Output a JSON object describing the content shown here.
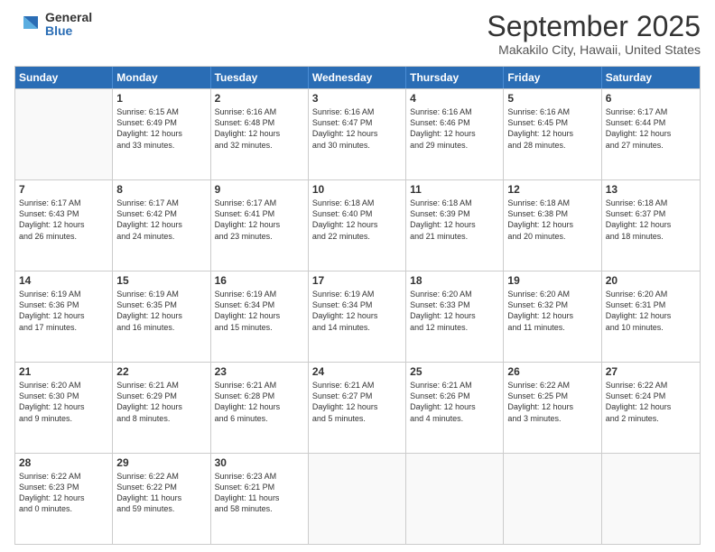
{
  "logo": {
    "general": "General",
    "blue": "Blue"
  },
  "title": "September 2025",
  "location": "Makakilo City, Hawaii, United States",
  "header_days": [
    "Sunday",
    "Monday",
    "Tuesday",
    "Wednesday",
    "Thursday",
    "Friday",
    "Saturday"
  ],
  "weeks": [
    [
      {
        "day": "",
        "text": ""
      },
      {
        "day": "1",
        "text": "Sunrise: 6:15 AM\nSunset: 6:49 PM\nDaylight: 12 hours\nand 33 minutes."
      },
      {
        "day": "2",
        "text": "Sunrise: 6:16 AM\nSunset: 6:48 PM\nDaylight: 12 hours\nand 32 minutes."
      },
      {
        "day": "3",
        "text": "Sunrise: 6:16 AM\nSunset: 6:47 PM\nDaylight: 12 hours\nand 30 minutes."
      },
      {
        "day": "4",
        "text": "Sunrise: 6:16 AM\nSunset: 6:46 PM\nDaylight: 12 hours\nand 29 minutes."
      },
      {
        "day": "5",
        "text": "Sunrise: 6:16 AM\nSunset: 6:45 PM\nDaylight: 12 hours\nand 28 minutes."
      },
      {
        "day": "6",
        "text": "Sunrise: 6:17 AM\nSunset: 6:44 PM\nDaylight: 12 hours\nand 27 minutes."
      }
    ],
    [
      {
        "day": "7",
        "text": "Sunrise: 6:17 AM\nSunset: 6:43 PM\nDaylight: 12 hours\nand 26 minutes."
      },
      {
        "day": "8",
        "text": "Sunrise: 6:17 AM\nSunset: 6:42 PM\nDaylight: 12 hours\nand 24 minutes."
      },
      {
        "day": "9",
        "text": "Sunrise: 6:17 AM\nSunset: 6:41 PM\nDaylight: 12 hours\nand 23 minutes."
      },
      {
        "day": "10",
        "text": "Sunrise: 6:18 AM\nSunset: 6:40 PM\nDaylight: 12 hours\nand 22 minutes."
      },
      {
        "day": "11",
        "text": "Sunrise: 6:18 AM\nSunset: 6:39 PM\nDaylight: 12 hours\nand 21 minutes."
      },
      {
        "day": "12",
        "text": "Sunrise: 6:18 AM\nSunset: 6:38 PM\nDaylight: 12 hours\nand 20 minutes."
      },
      {
        "day": "13",
        "text": "Sunrise: 6:18 AM\nSunset: 6:37 PM\nDaylight: 12 hours\nand 18 minutes."
      }
    ],
    [
      {
        "day": "14",
        "text": "Sunrise: 6:19 AM\nSunset: 6:36 PM\nDaylight: 12 hours\nand 17 minutes."
      },
      {
        "day": "15",
        "text": "Sunrise: 6:19 AM\nSunset: 6:35 PM\nDaylight: 12 hours\nand 16 minutes."
      },
      {
        "day": "16",
        "text": "Sunrise: 6:19 AM\nSunset: 6:34 PM\nDaylight: 12 hours\nand 15 minutes."
      },
      {
        "day": "17",
        "text": "Sunrise: 6:19 AM\nSunset: 6:34 PM\nDaylight: 12 hours\nand 14 minutes."
      },
      {
        "day": "18",
        "text": "Sunrise: 6:20 AM\nSunset: 6:33 PM\nDaylight: 12 hours\nand 12 minutes."
      },
      {
        "day": "19",
        "text": "Sunrise: 6:20 AM\nSunset: 6:32 PM\nDaylight: 12 hours\nand 11 minutes."
      },
      {
        "day": "20",
        "text": "Sunrise: 6:20 AM\nSunset: 6:31 PM\nDaylight: 12 hours\nand 10 minutes."
      }
    ],
    [
      {
        "day": "21",
        "text": "Sunrise: 6:20 AM\nSunset: 6:30 PM\nDaylight: 12 hours\nand 9 minutes."
      },
      {
        "day": "22",
        "text": "Sunrise: 6:21 AM\nSunset: 6:29 PM\nDaylight: 12 hours\nand 8 minutes."
      },
      {
        "day": "23",
        "text": "Sunrise: 6:21 AM\nSunset: 6:28 PM\nDaylight: 12 hours\nand 6 minutes."
      },
      {
        "day": "24",
        "text": "Sunrise: 6:21 AM\nSunset: 6:27 PM\nDaylight: 12 hours\nand 5 minutes."
      },
      {
        "day": "25",
        "text": "Sunrise: 6:21 AM\nSunset: 6:26 PM\nDaylight: 12 hours\nand 4 minutes."
      },
      {
        "day": "26",
        "text": "Sunrise: 6:22 AM\nSunset: 6:25 PM\nDaylight: 12 hours\nand 3 minutes."
      },
      {
        "day": "27",
        "text": "Sunrise: 6:22 AM\nSunset: 6:24 PM\nDaylight: 12 hours\nand 2 minutes."
      }
    ],
    [
      {
        "day": "28",
        "text": "Sunrise: 6:22 AM\nSunset: 6:23 PM\nDaylight: 12 hours\nand 0 minutes."
      },
      {
        "day": "29",
        "text": "Sunrise: 6:22 AM\nSunset: 6:22 PM\nDaylight: 11 hours\nand 59 minutes."
      },
      {
        "day": "30",
        "text": "Sunrise: 6:23 AM\nSunset: 6:21 PM\nDaylight: 11 hours\nand 58 minutes."
      },
      {
        "day": "",
        "text": ""
      },
      {
        "day": "",
        "text": ""
      },
      {
        "day": "",
        "text": ""
      },
      {
        "day": "",
        "text": ""
      }
    ]
  ]
}
